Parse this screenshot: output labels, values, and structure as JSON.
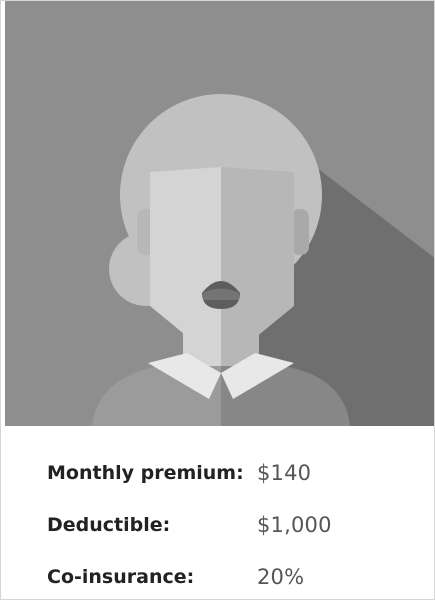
{
  "plan": {
    "avatar": {
      "icon": "woman-avatar-icon",
      "colors": {
        "background": "#8e8e8e",
        "shadow": "#6f6f6f",
        "hair": "#c1c1c1",
        "face_light": "#d4d4d4",
        "face_dark": "#b7b7b7",
        "collar": "#e8e8e8",
        "shirt_light": "#9b9b9b",
        "shirt_dark": "#878787",
        "mouth": "#5d5d5d"
      }
    },
    "details": [
      {
        "label": "Monthly premium:",
        "value": "$140"
      },
      {
        "label": "Deductible:",
        "value": "$1,000"
      },
      {
        "label": "Co-insurance:",
        "value": "20%"
      }
    ]
  }
}
